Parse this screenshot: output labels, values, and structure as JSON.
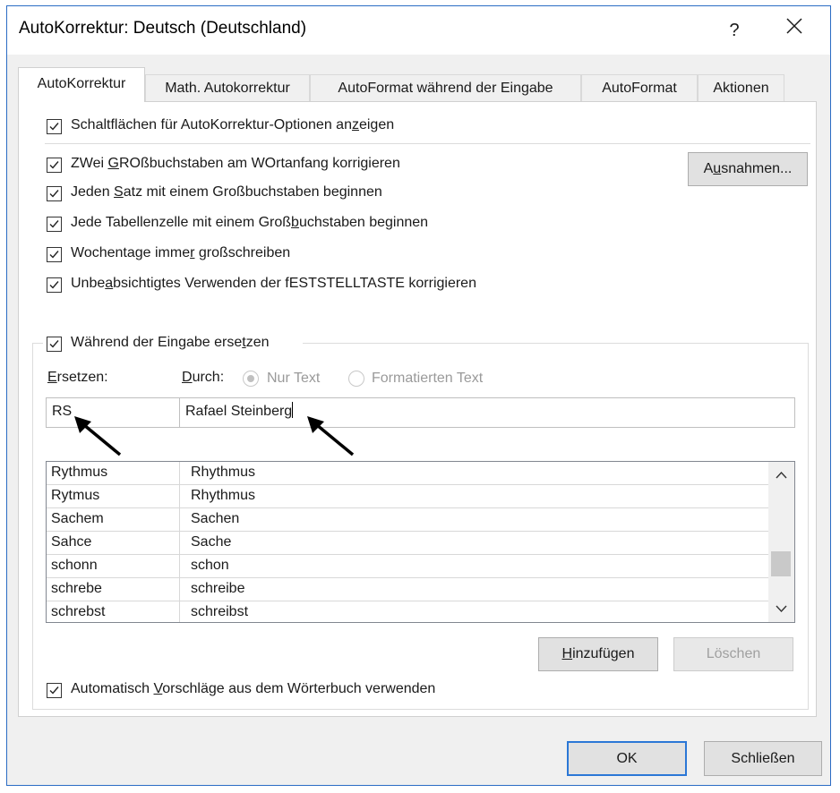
{
  "dialog": {
    "title": "AutoKorrektur: Deutsch (Deutschland)",
    "help_label": "?"
  },
  "tabs": [
    {
      "label": "AutoKorrektur",
      "active": true
    },
    {
      "label": "Math. Autokorrektur",
      "active": false
    },
    {
      "label": "AutoFormat während der Eingabe",
      "active": false
    },
    {
      "label": "AutoFormat",
      "active": false
    },
    {
      "label": "Aktionen",
      "active": false
    }
  ],
  "options": {
    "show_buttons": {
      "pre": "Schaltflächen für AutoKorrektur-Optionen an",
      "key": "z",
      "post": "eigen",
      "checked": true
    },
    "two_caps": {
      "pre": "ZWei ",
      "key": "G",
      "post": "ROßbuchstaben am WOrtanfang korrigieren",
      "checked": true
    },
    "sentence": {
      "pre": "Jeden ",
      "key": "S",
      "post": "atz mit einem Großbuchstaben beginnen",
      "checked": true
    },
    "table_cell": {
      "pre": "Jede Tabellenzelle mit einem Groß",
      "key": "b",
      "post": "uchstaben beginnen",
      "checked": true
    },
    "weekdays": {
      "pre": "Wochentage imme",
      "key": "r",
      "post": " großschreiben",
      "checked": true
    },
    "capslock": {
      "pre": "Unbe",
      "key": "a",
      "post": "bsichtigtes Verwenden der fESTSTELLTASTE korrigieren",
      "checked": true
    }
  },
  "exceptions_button": {
    "pre": "A",
    "key": "u",
    "post": "snahmen..."
  },
  "replace_group": {
    "checkbox": {
      "pre": "Während der Eingabe erse",
      "key": "t",
      "post": "zen",
      "checked": true
    },
    "replace_label": {
      "key": "E",
      "post": "rsetzen:"
    },
    "with_label": {
      "key": "D",
      "post": "urch:"
    },
    "radio_plain": "Nur Text",
    "radio_formatted": "Formatierten Text",
    "replace_value": "RS",
    "with_value": "Rafael Steinberg"
  },
  "entries": [
    {
      "from": "Rythmus",
      "to": "Rhythmus"
    },
    {
      "from": "Rytmus",
      "to": "Rhythmus"
    },
    {
      "from": "Sachem",
      "to": "Sachen"
    },
    {
      "from": "Sahce",
      "to": "Sache"
    },
    {
      "from": "schonn",
      "to": "schon"
    },
    {
      "from": "schrebe",
      "to": "schreibe"
    },
    {
      "from": "schrebst",
      "to": "schreibst"
    }
  ],
  "add_button": {
    "key": "H",
    "post": "inzufügen"
  },
  "delete_button": "Löschen",
  "suggestions": {
    "pre": "Automatisch ",
    "key": "V",
    "post": "orschläge aus dem Wörterbuch verwenden",
    "checked": true
  },
  "ok_button": "OK",
  "close_button": "Schließen",
  "colors": {
    "accent": "#2b77d6",
    "frame": "#2b6cc4",
    "background": "#f0f0f0"
  }
}
